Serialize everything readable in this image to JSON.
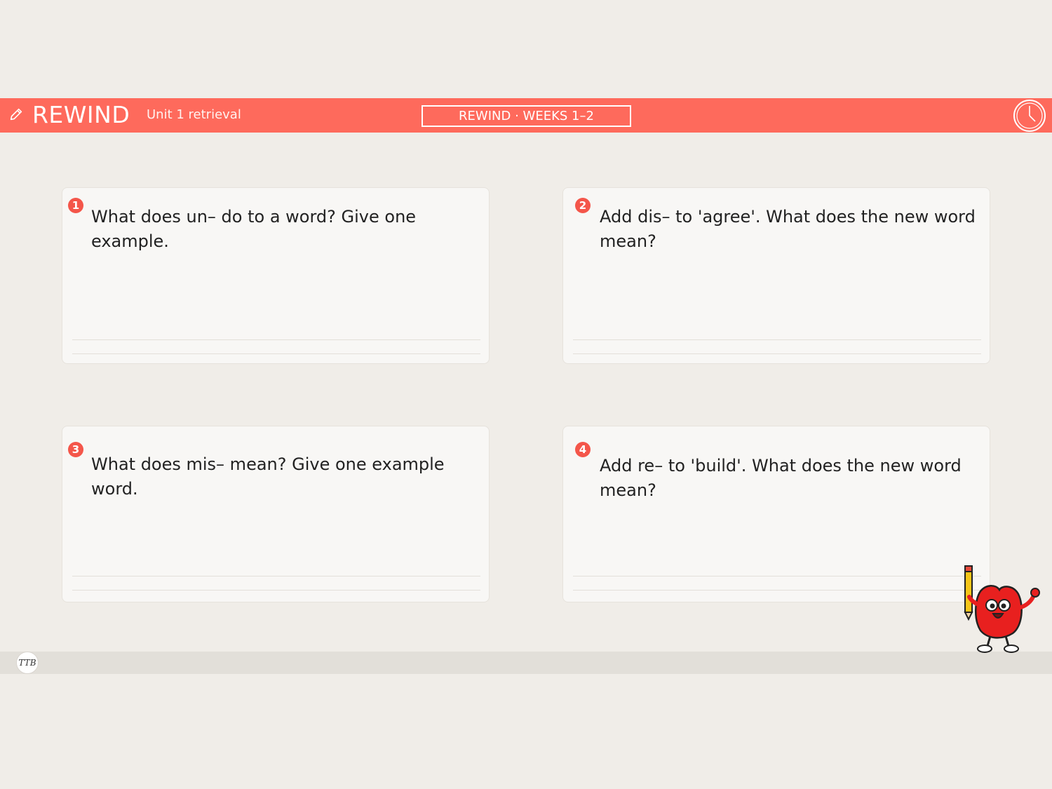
{
  "header": {
    "title": "REWIND",
    "subtitle": "Unit 1 retrieval",
    "badge": "REWIND · WEEKS 1–2",
    "accent": "#fe6a5c",
    "icons": [
      "pencil-icon",
      "clock-icon"
    ]
  },
  "questions": [
    {
      "number": "1",
      "text": "What does un– do to a word? Give one example."
    },
    {
      "number": "2",
      "text": "Add dis– to 'agree'. What does the new word mean?"
    },
    {
      "number": "3",
      "text": "What does mis– mean? Give one example word."
    },
    {
      "number": "4",
      "text": "Add re– to 'build'. What does the new word mean?"
    }
  ],
  "footer": {
    "logo_text": "TTB"
  },
  "mascot": {
    "icon": "apple-mascot-with-pencil"
  }
}
